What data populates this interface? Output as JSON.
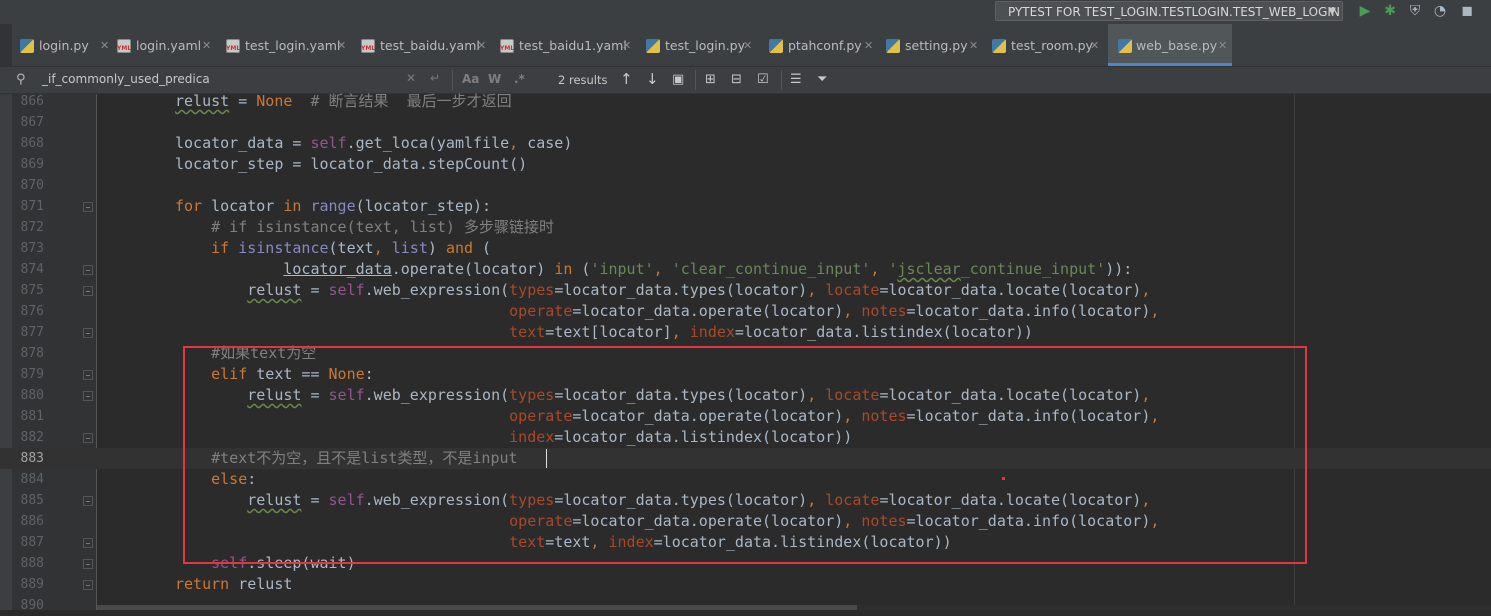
{
  "run_config": {
    "label": "PYTEST FOR TEST_LOGIN.TESTLOGIN.TEST_WEB_LOGIN"
  },
  "toolbar": {
    "colors": {
      "run": "#499c54",
      "debug": "#499c54"
    }
  },
  "tabs": [
    {
      "label": "login.py",
      "type": "py",
      "active": false
    },
    {
      "label": "login.yaml",
      "type": "yml",
      "active": false
    },
    {
      "label": "test_login.yaml",
      "type": "yml",
      "active": false
    },
    {
      "label": "test_baidu.yaml",
      "type": "yml",
      "active": false
    },
    {
      "label": "test_baidu1.yaml",
      "type": "yml",
      "active": false
    },
    {
      "label": "test_login.py",
      "type": "py",
      "active": false
    },
    {
      "label": "ptahconf.py",
      "type": "py",
      "active": false
    },
    {
      "label": "setting.py",
      "type": "py",
      "active": false
    },
    {
      "label": "test_room.py",
      "type": "py",
      "active": false
    },
    {
      "label": "web_base.py",
      "type": "py",
      "active": true
    }
  ],
  "find": {
    "query": "_if_commonly_used_predica",
    "results": "2 results",
    "match_case": "Aa",
    "words": "W",
    "regex": ".*"
  },
  "editor": {
    "current_line": "883",
    "lines": [
      {
        "num": "866",
        "text": "relust = None  # 断言结果  最后一步才返回"
      },
      {
        "num": "867",
        "text": ""
      },
      {
        "num": "868",
        "text": "locator_data = self.get_loca(yamlfile, case)"
      },
      {
        "num": "869",
        "text": "locator_step = locator_data.stepCount()"
      },
      {
        "num": "870",
        "text": ""
      },
      {
        "num": "871",
        "text": "for locator in range(locator_step):"
      },
      {
        "num": "872",
        "text": "    # if isinstance(text, list) 多步骤链接时"
      },
      {
        "num": "873",
        "text": "    if isinstance(text, list) and ("
      },
      {
        "num": "874",
        "text": "            locator_data.operate(locator) in ('input', 'clear_continue_input', 'jsclear_continue_input')):"
      },
      {
        "num": "875",
        "text": "        relust = self.web_expression(types=locator_data.types(locator), locate=locator_data.locate(locator),"
      },
      {
        "num": "876",
        "text": "                                     operate=locator_data.operate(locator), notes=locator_data.info(locator),"
      },
      {
        "num": "877",
        "text": "                                     text=text[locator], index=locator_data.listindex(locator))"
      },
      {
        "num": "878",
        "text": "    #如果text为空"
      },
      {
        "num": "879",
        "text": "    elif text == None:"
      },
      {
        "num": "880",
        "text": "        relust = self.web_expression(types=locator_data.types(locator), locate=locator_data.locate(locator),"
      },
      {
        "num": "881",
        "text": "                                     operate=locator_data.operate(locator), notes=locator_data.info(locator),"
      },
      {
        "num": "882",
        "text": "                                     index=locator_data.listindex(locator))"
      },
      {
        "num": "883",
        "text": "    #text不为空，且不是list类型，不是input"
      },
      {
        "num": "884",
        "text": "    else:"
      },
      {
        "num": "885",
        "text": "        relust = self.web_expression(types=locator_data.types(locator), locate=locator_data.locate(locator),"
      },
      {
        "num": "886",
        "text": "                                     operate=locator_data.operate(locator), notes=locator_data.info(locator),"
      },
      {
        "num": "887",
        "text": "                                     text=text, index=locator_data.listindex(locator))"
      },
      {
        "num": "888",
        "text": "    self.sleep(wait)"
      },
      {
        "num": "889",
        "text": "return relust"
      },
      {
        "num": "890",
        "text": ""
      }
    ]
  },
  "annotation": {
    "color": "#e0383e"
  }
}
